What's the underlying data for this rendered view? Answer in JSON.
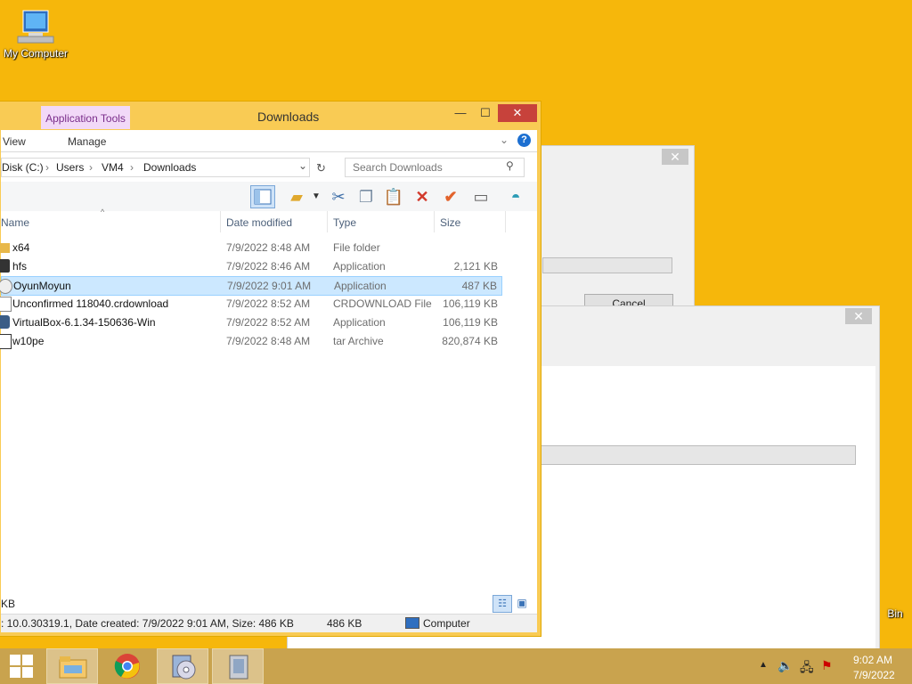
{
  "desktop": {
    "icons": [
      {
        "label": "My Computer"
      },
      {
        "label": "Bin"
      }
    ]
  },
  "background_dialogs": {
    "cancel_label": "Cancel"
  },
  "explorer": {
    "title": "Downloads",
    "contextual_tab": "Application Tools",
    "ribbon": {
      "view_tab": "View",
      "manage_tab": "Manage"
    },
    "address": {
      "crumbs": [
        "Disk (C:)",
        "Users",
        "VM4",
        "Downloads"
      ],
      "search_placeholder": "Search Downloads"
    },
    "columns": {
      "name": "Name",
      "date": "Date modified",
      "type": "Type",
      "size": "Size"
    },
    "files": [
      {
        "name": "x64",
        "date": "7/9/2022 8:48 AM",
        "type": "File folder",
        "size": "",
        "icon": "folder-icon"
      },
      {
        "name": "hfs",
        "date": "7/9/2022 8:46 AM",
        "type": "Application",
        "size": "2,121 KB",
        "icon": "hfs-app-icon"
      },
      {
        "name": "OyunMoyun",
        "date": "7/9/2022 9:01 AM",
        "type": "Application",
        "size": "487 KB",
        "icon": "app-icon",
        "selected": true
      },
      {
        "name": "Unconfirmed 118040.crdownload",
        "date": "7/9/2022 8:52 AM",
        "type": "CRDOWNLOAD File",
        "size": "106,119 KB",
        "icon": "file-icon"
      },
      {
        "name": "VirtualBox-6.1.34-150636-Win",
        "date": "7/9/2022 8:52 AM",
        "type": "Application",
        "size": "106,119 KB",
        "icon": "installer-icon"
      },
      {
        "name": "w10pe",
        "date": "7/9/2022 8:48 AM",
        "type": "tar Archive",
        "size": "820,874 KB",
        "icon": "archive-icon"
      }
    ],
    "bottom_left": "KB",
    "status": {
      "details": ": 10.0.30319.1, Date created: 7/9/2022 9:01 AM, Size: 486 KB",
      "size": "486 KB",
      "location": "Computer"
    }
  },
  "taskbar": {
    "clock_time": "9:02 AM",
    "clock_date": "7/9/2022"
  },
  "colors": {
    "desktop": "#f6b70b",
    "window_frame": "#f9cb54",
    "selection": "#cce8ff",
    "close": "#c7423b",
    "taskbar": "#c9a34e"
  }
}
